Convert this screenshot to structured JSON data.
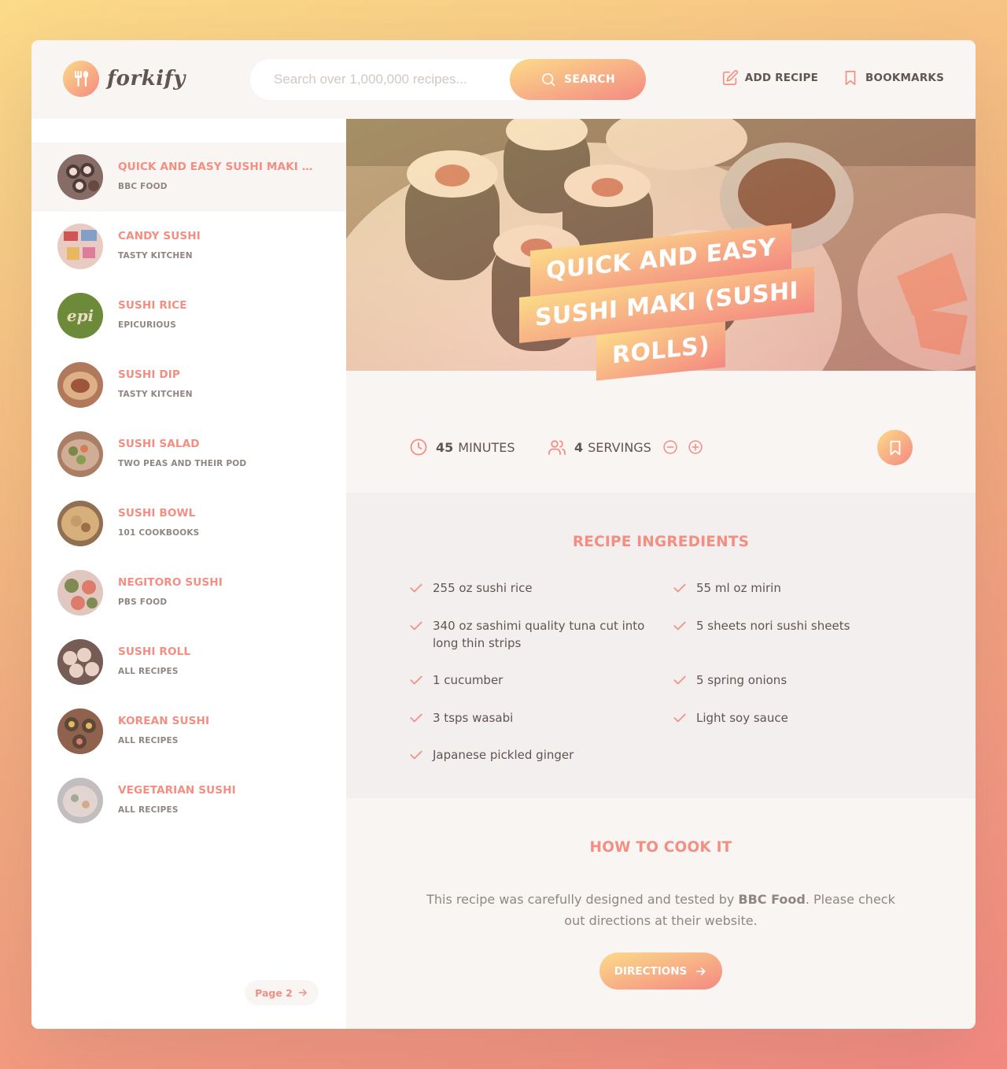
{
  "header": {
    "logo_text": "forkify",
    "search_placeholder": "Search over 1,000,000 recipes...",
    "search_button": "SEARCH",
    "nav": {
      "add_recipe": "ADD RECIPE",
      "bookmarks": "BOOKMARKS"
    }
  },
  "results": [
    {
      "title": "QUICK AND EASY SUSHI MAKI (SU...",
      "publisher": "BBC FOOD",
      "thumb": "sushi-maki"
    },
    {
      "title": "CANDY SUSHI",
      "publisher": "TASTY KITCHEN",
      "thumb": "candy"
    },
    {
      "title": "SUSHI RICE",
      "publisher": "EPICURIOUS",
      "thumb": "epi",
      "thumb_text": "epi"
    },
    {
      "title": "SUSHI DIP",
      "publisher": "TASTY KITCHEN",
      "thumb": "dip"
    },
    {
      "title": "SUSHI SALAD",
      "publisher": "TWO PEAS AND THEIR POD",
      "thumb": "salad"
    },
    {
      "title": "SUSHI BOWL",
      "publisher": "101 COOKBOOKS",
      "thumb": "bowl"
    },
    {
      "title": "NEGITORO SUSHI",
      "publisher": "PBS FOOD",
      "thumb": "negitoro"
    },
    {
      "title": "SUSHI ROLL",
      "publisher": "ALL RECIPES",
      "thumb": "roll"
    },
    {
      "title": "KOREAN SUSHI",
      "publisher": "ALL RECIPES",
      "thumb": "korean"
    },
    {
      "title": "VEGETARIAN SUSHI",
      "publisher": "ALL RECIPES",
      "thumb": "vegetarian"
    }
  ],
  "pagination": {
    "next_label": "Page 2"
  },
  "recipe": {
    "title_lines": [
      "QUICK AND EASY",
      "SUSHI MAKI (SUSHI",
      "ROLLS)"
    ],
    "cooking_time": "45",
    "cooking_time_unit": "MINUTES",
    "servings": "4",
    "servings_unit": "SERVINGS",
    "ingredients_heading": "RECIPE INGREDIENTS",
    "ingredients": [
      "255 oz sushi rice",
      "55 ml oz mirin",
      "340 oz sashimi quality tuna cut into long thin strips",
      "5 sheets nori sushi sheets",
      "1 cucumber",
      "5 spring onions",
      "3 tsps wasabi",
      "Light soy sauce",
      "Japanese pickled ginger"
    ],
    "cook_heading": "HOW TO COOK IT",
    "cook_text_before": "This recipe was carefully designed and tested by ",
    "cook_publisher": "BBC Food",
    "cook_text_after": ". Please check out directions at their website.",
    "directions_button": "DIRECTIONS"
  },
  "colors": {
    "accent": "#f38e82",
    "gradient_start": "#fbdb89",
    "gradient_end": "#f48982",
    "text": "#615551",
    "muted": "#918581"
  }
}
